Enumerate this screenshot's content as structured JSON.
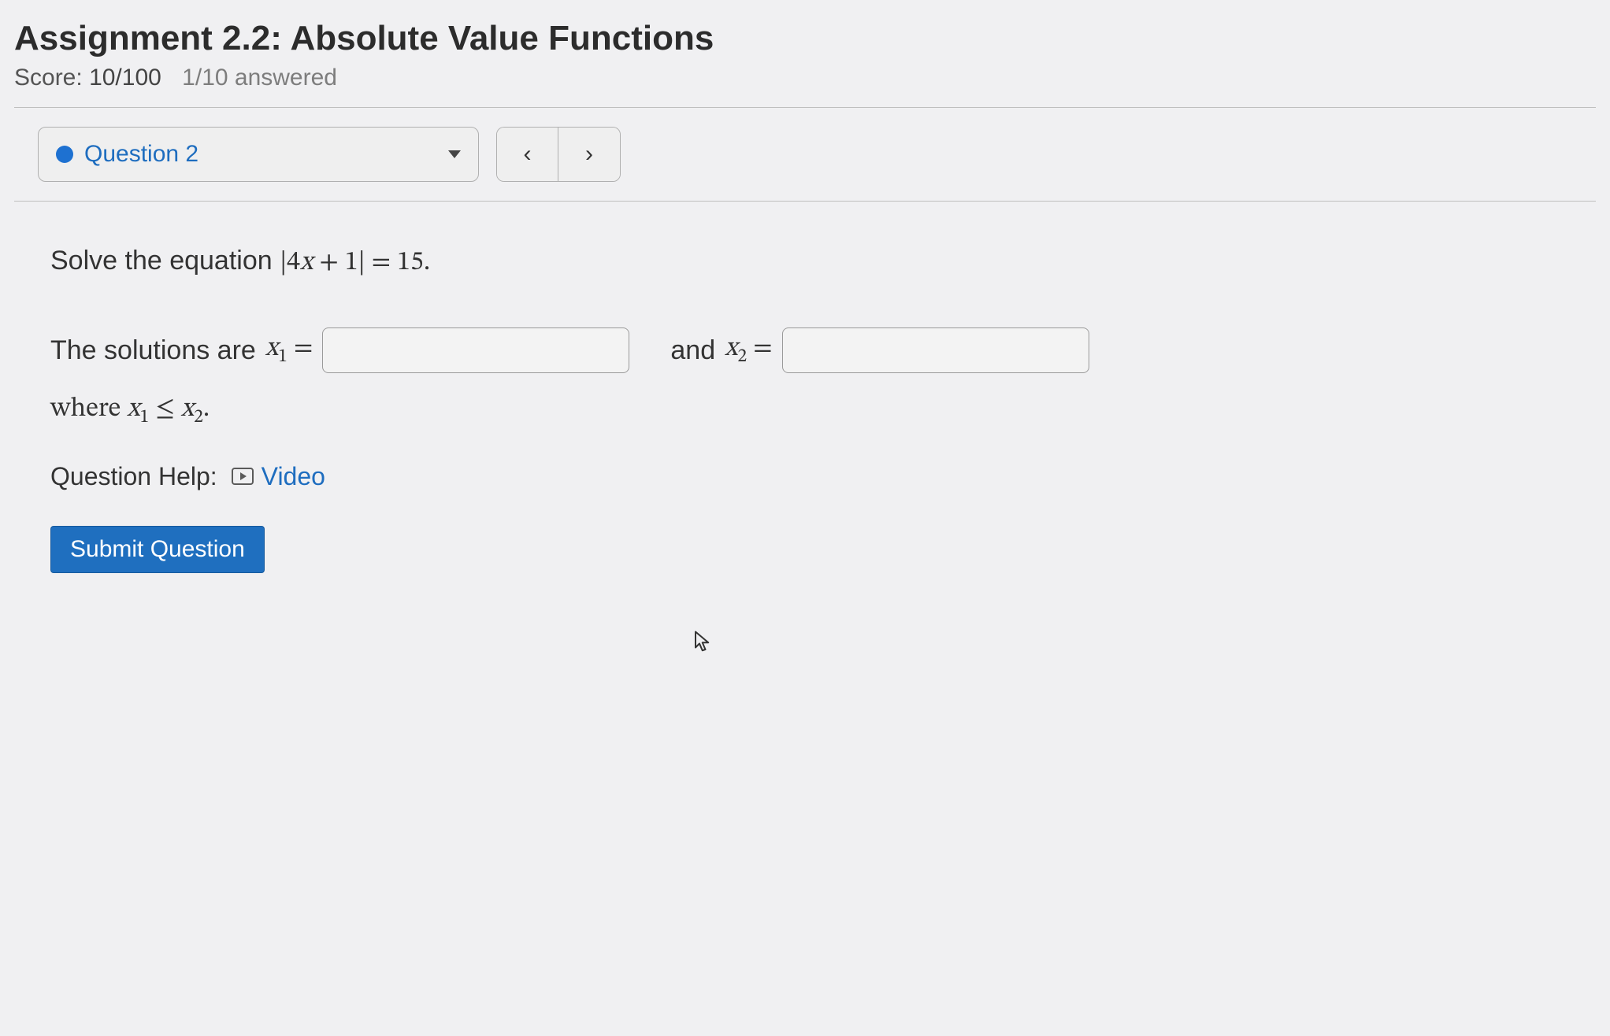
{
  "header": {
    "title": "Assignment 2.2: Absolute Value Functions",
    "score_label": "Score:",
    "score_value": "10/100",
    "answered": "1/10 answered"
  },
  "nav": {
    "question_label": "Question 2",
    "prev_symbol": "‹",
    "next_symbol": "›"
  },
  "problem": {
    "lead": "Solve the equation ",
    "equation": "|4x + 1| = 15.",
    "solutions_lead": "The solutions are ",
    "x1_label": "x₁ =",
    "and_label": "and",
    "x2_label": "x₂ =",
    "where_text": "where x₁ ≤ x₂.",
    "x1_value": "",
    "x2_value": ""
  },
  "help": {
    "label": "Question Help:",
    "video_label": "Video"
  },
  "actions": {
    "submit_label": "Submit Question"
  }
}
